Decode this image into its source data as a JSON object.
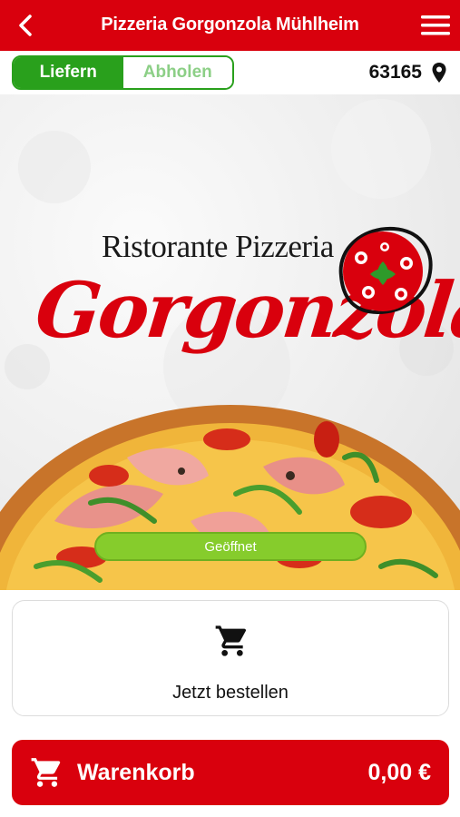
{
  "header": {
    "title": "Pizzeria Gorgonzola Mühlheim",
    "back_icon": "chevron-left-icon",
    "menu_icon": "hamburger-menu-icon",
    "background_color": "#d9000d"
  },
  "delivery_mode": {
    "options": [
      "Liefern",
      "Abholen"
    ],
    "selected": "Liefern",
    "accent_color": "#29a01c"
  },
  "location": {
    "zip": "63165",
    "icon": "location-pin-icon"
  },
  "hero": {
    "logo_line1": "Ristorante Pizzeria",
    "logo_line2": "Gorgonzola",
    "status": "Geöffnet",
    "status_color": "#86cc2c"
  },
  "order_card": {
    "icon": "shopping-cart-icon",
    "label": "Jetzt bestellen"
  },
  "basket": {
    "icon": "shopping-cart-icon",
    "label": "Warenkorb",
    "total": "0,00 €"
  }
}
